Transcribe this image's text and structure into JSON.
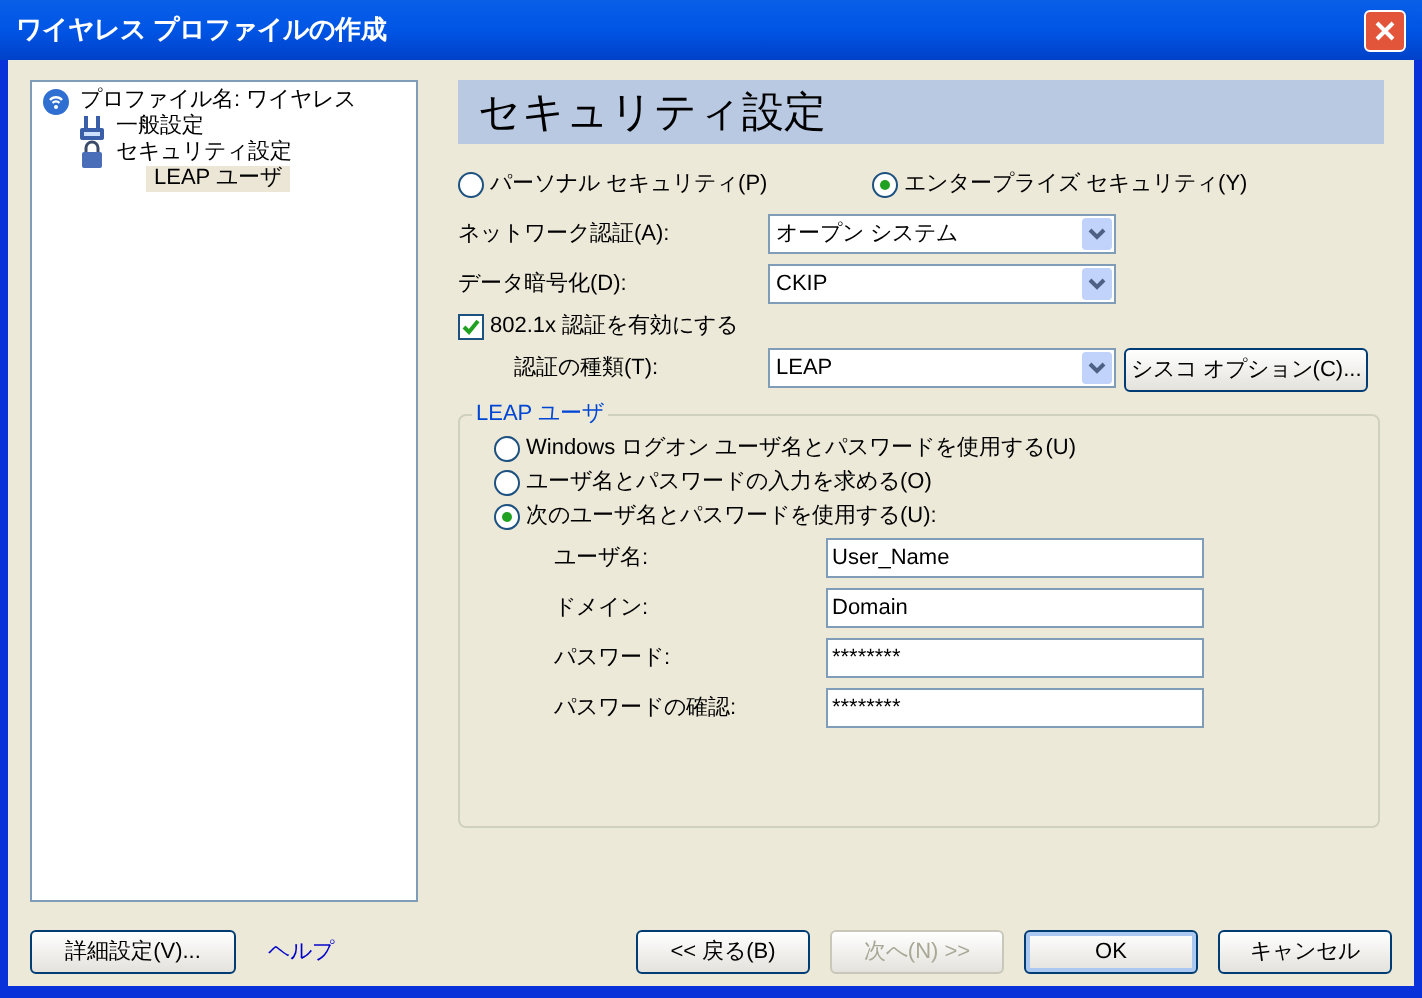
{
  "window": {
    "title": "ワイヤレス プロファイルの作成"
  },
  "tree": {
    "items": [
      {
        "label": "プロファイル名: ワイヤレス",
        "selected": false,
        "children": [
          {
            "label": "一般設定",
            "selected": false
          },
          {
            "label": "セキュリティ設定",
            "selected": false,
            "children": [
              {
                "label": "LEAP ユーザ",
                "selected": true
              }
            ]
          }
        ]
      }
    ]
  },
  "header": "セキュリティ設定",
  "security_modes": [
    {
      "label": "パーソナル セキュリティ(P)",
      "selected": false
    },
    {
      "label": "エンタープライズ セキュリティ(Y)",
      "selected": true
    }
  ],
  "dropdowns": [
    {
      "label": "ネットワーク認証(A):",
      "value": "オープン システム"
    },
    {
      "label": "データ暗号化(D):",
      "value": "CKIP"
    }
  ],
  "enable_8021x": {
    "label": "802.1x 認証を有効にする",
    "checked": true
  },
  "auth_type": {
    "label": "認証の種類(T):",
    "value": "LEAP",
    "button": "シスコ オプション(C)..."
  },
  "leap": {
    "title": "LEAP ユーザ",
    "options": [
      {
        "label": "Windows ログオン ユーザ名とパスワードを使用する(U)",
        "selected": false
      },
      {
        "label": "ユーザ名とパスワードの入力を求める(O)",
        "selected": false
      },
      {
        "label": "次のユーザ名とパスワードを使用する(U):",
        "selected": true
      }
    ],
    "fields": [
      {
        "label": "ユーザ名:",
        "value": "User_Name"
      },
      {
        "label": "ドメイン:",
        "value": "Domain"
      },
      {
        "label": "パスワード:",
        "value": "********"
      },
      {
        "label": "パスワードの確認:",
        "value": "********"
      }
    ]
  },
  "footer": {
    "advanced": "詳細設定(V)...",
    "help": "ヘルプ",
    "buttons": [
      {
        "label": "<< 戻る(B)",
        "disabled": false,
        "default": false
      },
      {
        "label": "次へ(N) >>",
        "disabled": true,
        "default": false
      },
      {
        "label": "OK",
        "disabled": false,
        "default": true
      },
      {
        "label": "キャンセル",
        "disabled": false,
        "default": false
      }
    ]
  }
}
